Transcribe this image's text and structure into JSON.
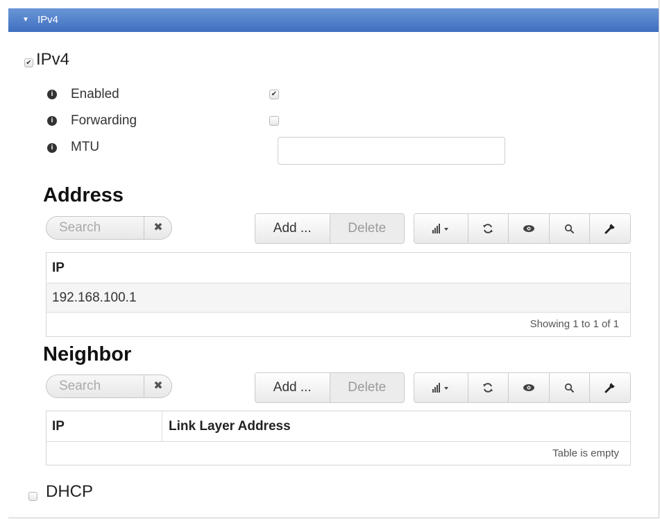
{
  "section_bar": {
    "title": "IPv4"
  },
  "ipv4_group": {
    "label": "IPv4",
    "checked": true
  },
  "properties": [
    {
      "label": "Enabled",
      "checked": true
    },
    {
      "label": "Forwarding",
      "checked": false
    },
    {
      "label": "MTU",
      "value": ""
    }
  ],
  "address": {
    "heading": "Address",
    "search_placeholder": "Search",
    "add_label": "Add ...",
    "delete_label": "Delete",
    "columns": [
      "IP"
    ],
    "rows": [
      [
        "192.168.100.1"
      ]
    ],
    "footer": "Showing 1 to 1 of 1"
  },
  "neighbor": {
    "heading": "Neighbor",
    "search_placeholder": "Search",
    "add_label": "Add ...",
    "delete_label": "Delete",
    "columns": [
      "IP",
      "Link Layer Address"
    ],
    "rows": [],
    "footer": "Table is empty"
  },
  "dhcp_group": {
    "label": "DHCP",
    "checked": false
  },
  "toolbar_icons": [
    "signal-dropdown-icon",
    "refresh-icon",
    "eye-icon",
    "search-icon",
    "wrench-icon"
  ],
  "colors": {
    "section_bar_top": "#6a96d6",
    "section_bar_bottom": "#3f6fc0"
  }
}
